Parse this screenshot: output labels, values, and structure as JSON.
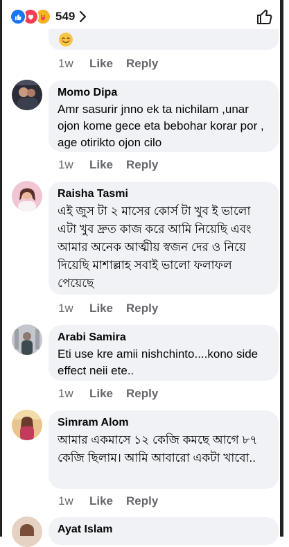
{
  "header": {
    "reaction_count": "549",
    "reaction_icons": [
      "like-icon",
      "love-icon",
      "care-icon"
    ]
  },
  "previous_comment": {
    "emoji": "😊",
    "time": "1w",
    "like_label": "Like",
    "reply_label": "Reply"
  },
  "comments": [
    {
      "name": "Momo Dipa",
      "text": "Amr sasurir jnno ek ta nichilam ,unar ojon kome gece eta bebohar korar por , age otirikto ojon cilo",
      "time": "1w",
      "like_label": "Like",
      "reply_label": "Reply"
    },
    {
      "name": "Raisha Tasmi",
      "text": "এই জুস টা ২ মাসের কোর্স টা খুব ই ভালো এটা খুব দ্রুত কাজ করে আমি নিয়েছি এবং আমার অনেক  আত্মীয় স্বজন দের ও নিয়ে দিয়েছি মাশাল্লাহ সবাই ভালো ফলাফল পেয়েছে",
      "time": "1w",
      "like_label": "Like",
      "reply_label": "Reply"
    },
    {
      "name": "Arabi Samira",
      "text": "Eti use kre amii nishchinto....kono side effect neii ete..",
      "time": "1w",
      "like_label": "Like",
      "reply_label": "Reply"
    },
    {
      "name": "Simram Alom",
      "text": "আমার একমাসে ১২ কেজি কমছে আগে ৮৭  কেজি ছিলাম। আমি আবারো একটা খাবো..",
      "time": "1w",
      "like_label": "Like",
      "reply_label": "Reply"
    },
    {
      "name": "Ayat Islam"
    }
  ],
  "colors": {
    "bubble": "#f0f2f5",
    "meta_text": "#65676b",
    "like_blue": "#1877f2",
    "love_red": "#f33e58",
    "care_yellow": "#f7b125"
  }
}
